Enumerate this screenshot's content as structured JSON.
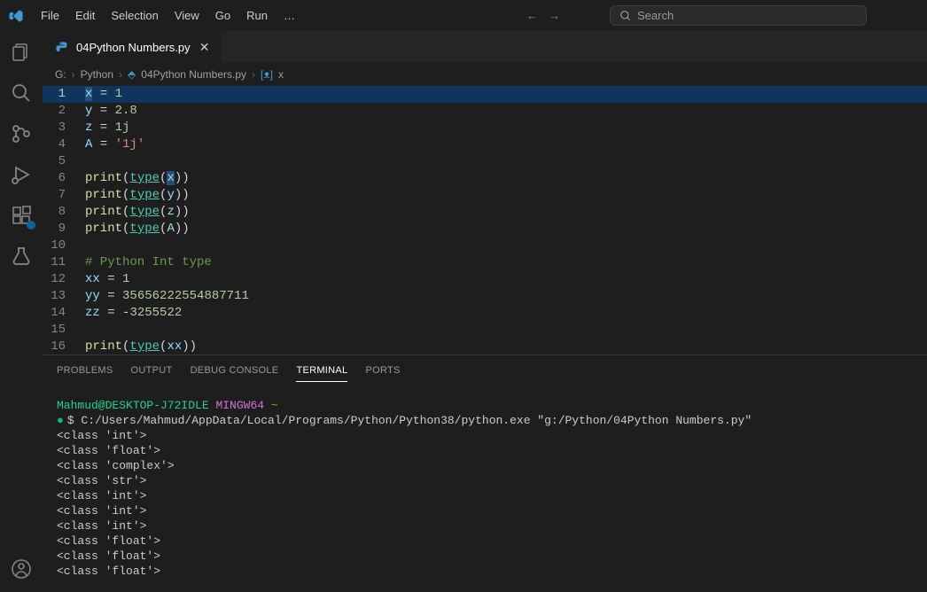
{
  "menu": {
    "items": [
      "File",
      "Edit",
      "Selection",
      "View",
      "Go",
      "Run"
    ],
    "ellipsis": "…"
  },
  "search": {
    "placeholder": "Search"
  },
  "tab": {
    "filename": "04Python Numbers.py"
  },
  "breadcrumb": {
    "drive": "G:",
    "folder": "Python",
    "file": "04Python Numbers.py",
    "symbol": "x"
  },
  "code": {
    "lines": [
      {
        "n": "1",
        "tokens": [
          {
            "c": "tk-var tk-sel",
            "t": "x"
          },
          {
            "c": "tk-op",
            "t": " = "
          },
          {
            "c": "tk-num",
            "t": "1"
          }
        ]
      },
      {
        "n": "2",
        "tokens": [
          {
            "c": "tk-var",
            "t": "y"
          },
          {
            "c": "tk-op",
            "t": " = "
          },
          {
            "c": "tk-num",
            "t": "2.8"
          }
        ]
      },
      {
        "n": "3",
        "tokens": [
          {
            "c": "tk-var",
            "t": "z"
          },
          {
            "c": "tk-op",
            "t": " = "
          },
          {
            "c": "tk-num",
            "t": "1j"
          }
        ]
      },
      {
        "n": "4",
        "tokens": [
          {
            "c": "tk-var",
            "t": "A"
          },
          {
            "c": "tk-op",
            "t": " = "
          },
          {
            "c": "tk-str",
            "t": "'1j'"
          }
        ]
      },
      {
        "n": "5",
        "tokens": []
      },
      {
        "n": "6",
        "tokens": [
          {
            "c": "tk-fn",
            "t": "print"
          },
          {
            "c": "tk-punc",
            "t": "("
          },
          {
            "c": "tk-builtin",
            "t": "type"
          },
          {
            "c": "tk-punc",
            "t": "("
          },
          {
            "c": "tk-var tk-sel",
            "t": "x"
          },
          {
            "c": "tk-punc",
            "t": "))"
          }
        ]
      },
      {
        "n": "7",
        "tokens": [
          {
            "c": "tk-fn",
            "t": "print"
          },
          {
            "c": "tk-punc",
            "t": "("
          },
          {
            "c": "tk-builtin",
            "t": "type"
          },
          {
            "c": "tk-punc",
            "t": "("
          },
          {
            "c": "tk-var",
            "t": "y"
          },
          {
            "c": "tk-punc",
            "t": "))"
          }
        ]
      },
      {
        "n": "8",
        "tokens": [
          {
            "c": "tk-fn",
            "t": "print"
          },
          {
            "c": "tk-punc",
            "t": "("
          },
          {
            "c": "tk-builtin",
            "t": "type"
          },
          {
            "c": "tk-punc",
            "t": "("
          },
          {
            "c": "tk-var",
            "t": "z"
          },
          {
            "c": "tk-punc",
            "t": "))"
          }
        ]
      },
      {
        "n": "9",
        "tokens": [
          {
            "c": "tk-fn",
            "t": "print"
          },
          {
            "c": "tk-punc",
            "t": "("
          },
          {
            "c": "tk-builtin",
            "t": "type"
          },
          {
            "c": "tk-punc",
            "t": "("
          },
          {
            "c": "tk-var",
            "t": "A"
          },
          {
            "c": "tk-punc",
            "t": "))"
          }
        ]
      },
      {
        "n": "10",
        "tokens": []
      },
      {
        "n": "11",
        "tokens": [
          {
            "c": "tk-comment",
            "t": "# Python Int type"
          }
        ]
      },
      {
        "n": "12",
        "tokens": [
          {
            "c": "tk-var",
            "t": "xx"
          },
          {
            "c": "tk-op",
            "t": " = "
          },
          {
            "c": "tk-num",
            "t": "1"
          }
        ]
      },
      {
        "n": "13",
        "tokens": [
          {
            "c": "tk-var",
            "t": "yy"
          },
          {
            "c": "tk-op",
            "t": " = "
          },
          {
            "c": "tk-num",
            "t": "35656222554887711"
          }
        ]
      },
      {
        "n": "14",
        "tokens": [
          {
            "c": "tk-var",
            "t": "zz"
          },
          {
            "c": "tk-op",
            "t": " = "
          },
          {
            "c": "tk-op",
            "t": "-"
          },
          {
            "c": "tk-num",
            "t": "3255522"
          }
        ]
      },
      {
        "n": "15",
        "tokens": []
      },
      {
        "n": "16",
        "tokens": [
          {
            "c": "tk-fn",
            "t": "print"
          },
          {
            "c": "tk-punc",
            "t": "("
          },
          {
            "c": "tk-builtin",
            "t": "type"
          },
          {
            "c": "tk-punc",
            "t": "("
          },
          {
            "c": "tk-var",
            "t": "xx"
          },
          {
            "c": "tk-punc",
            "t": "))"
          }
        ]
      }
    ],
    "active_line": 0
  },
  "panel": {
    "tabs": [
      "PROBLEMS",
      "OUTPUT",
      "DEBUG CONSOLE",
      "TERMINAL",
      "PORTS"
    ],
    "active": 3
  },
  "terminal": {
    "user": "Mahmud@DESKTOP-J72IDLE",
    "host": "MINGW64",
    "path": "~",
    "prompt": "$",
    "command": "C:/Users/Mahmud/AppData/Local/Programs/Python/Python38/python.exe \"g:/Python/04Python Numbers.py\"",
    "output": [
      "<class 'int'>",
      "<class 'float'>",
      "<class 'complex'>",
      "<class 'str'>",
      "<class 'int'>",
      "<class 'int'>",
      "<class 'int'>",
      "<class 'float'>",
      "<class 'float'>",
      "<class 'float'>"
    ]
  }
}
